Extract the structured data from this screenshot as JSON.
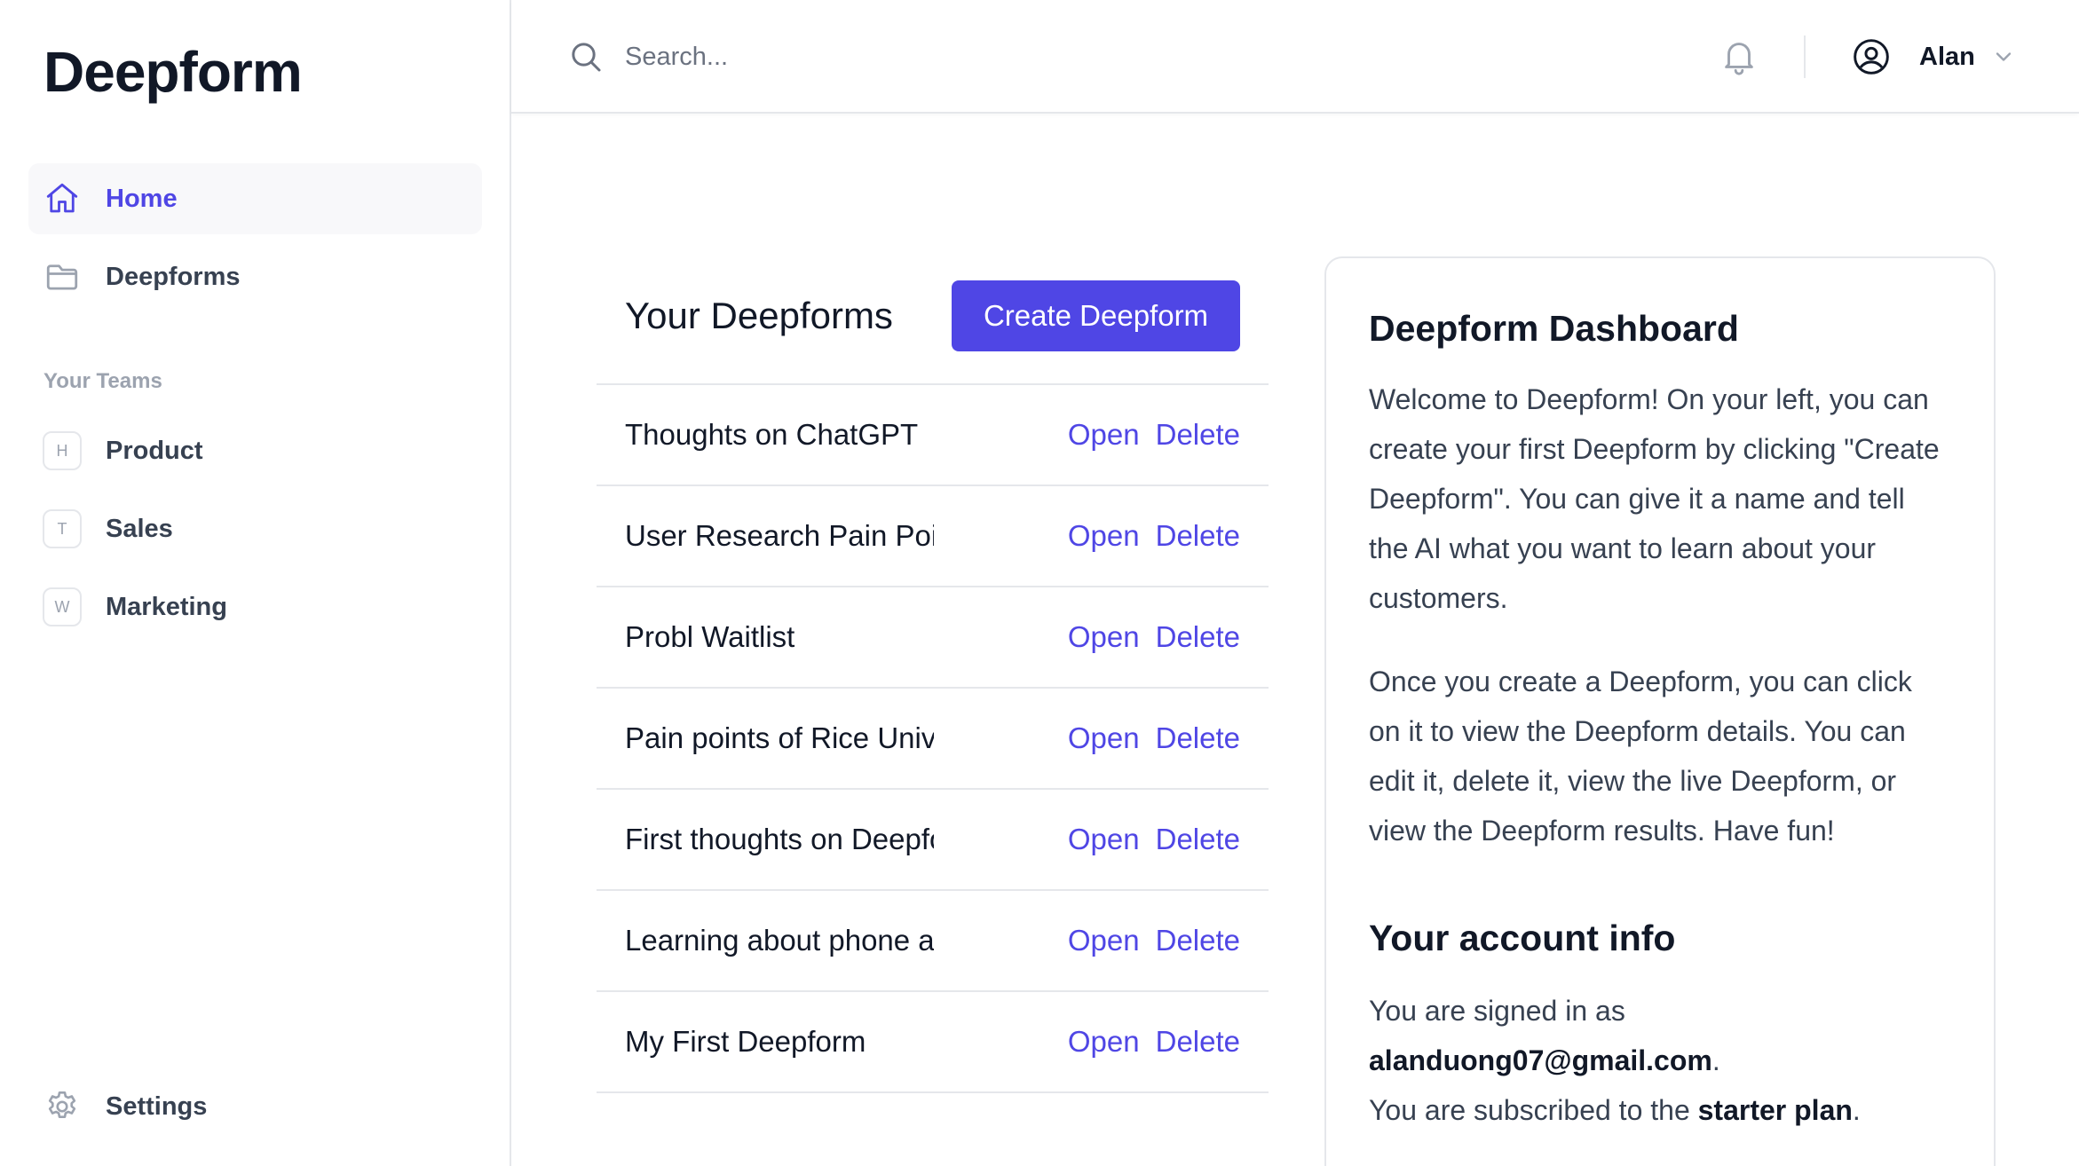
{
  "app": {
    "logo": "Deepform"
  },
  "sidebar": {
    "nav": [
      {
        "label": "Home",
        "icon": "home-icon",
        "active": true
      },
      {
        "label": "Deepforms",
        "icon": "folder-icon",
        "active": false
      }
    ],
    "teams_title": "Your Teams",
    "teams": [
      {
        "initial": "H",
        "label": "Product"
      },
      {
        "initial": "T",
        "label": "Sales"
      },
      {
        "initial": "W",
        "label": "Marketing"
      }
    ],
    "settings_label": "Settings"
  },
  "header": {
    "search_placeholder": "Search...",
    "user_name": "Alan"
  },
  "main": {
    "title": "Your Deepforms",
    "create_label": "Create Deepform",
    "open_label": "Open",
    "delete_label": "Delete",
    "rows": [
      "Thoughts on ChatGPT",
      "User Research Pain Points",
      "Probl Waitlist",
      "Pain points of Rice University",
      "First thoughts on Deepform",
      "Learning about phone addiction",
      "My First Deepform"
    ]
  },
  "dashboard": {
    "title": "Deepform Dashboard",
    "para1": "Welcome to Deepform! On your left, you can create your first Deepform by clicking \"Create Deepform\". You can give it a name and tell the AI what you want to learn about your customers.",
    "para2": "Once you create a Deepform, you can click on it to view the Deepform details. You can edit it, delete it, view the live Deepform, or view the Deepform results. Have fun!",
    "account_title": "Your account info",
    "signed_in_prefix": "You are signed in as",
    "email": "alanduong07@gmail.com",
    "period": ".",
    "plan_prefix": "You are subscribed to the",
    "plan": "starter plan",
    "plan_suffix": "."
  },
  "colors": {
    "accent": "#4f46e5",
    "text_primary": "#111827",
    "text_secondary": "#374151",
    "muted": "#9ca3af",
    "border": "#e5e7eb"
  }
}
